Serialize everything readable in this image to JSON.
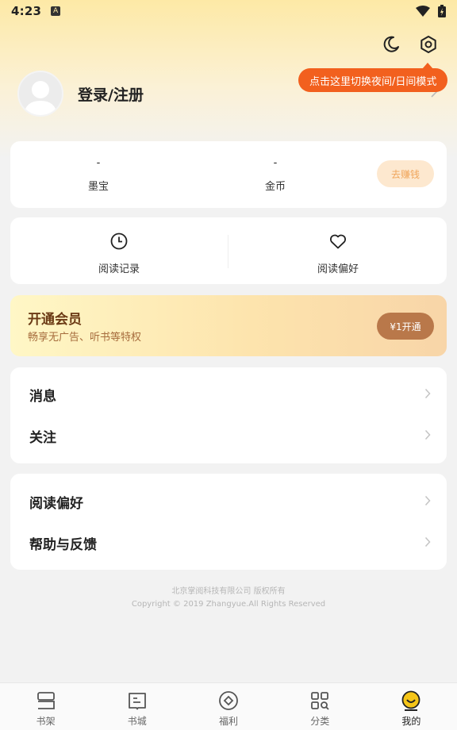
{
  "status_bar": {
    "time": "4:23",
    "notification_badge": "A"
  },
  "header": {
    "night_mode_tip": "点击这里切换夜间/日间模式",
    "icons": [
      "moon-icon",
      "settings-icon"
    ]
  },
  "profile": {
    "login_label": "登录/注册"
  },
  "wallet": {
    "items": [
      {
        "value": "-",
        "label": "墨宝"
      },
      {
        "value": "-",
        "label": "金币"
      }
    ],
    "earn_button": "去赚钱"
  },
  "shortcuts": [
    {
      "label": "阅读记录",
      "icon": "clock-icon"
    },
    {
      "label": "阅读偏好",
      "icon": "heart-icon"
    }
  ],
  "vip": {
    "title": "开通会员",
    "subtitle": "畅享无广告、听书等特权",
    "button": "¥1开通"
  },
  "menu_group_1": [
    {
      "label": "消息"
    },
    {
      "label": "关注"
    }
  ],
  "menu_group_2": [
    {
      "label": "阅读偏好"
    },
    {
      "label": "帮助与反馈"
    }
  ],
  "footer": {
    "company": "北京掌阅科技有限公司 版权所有",
    "copyright": "Copyright © 2019 Zhangyue.All Rights Reserved"
  },
  "tabbar": {
    "tabs": [
      {
        "label": "书架",
        "icon": "bookshelf-icon"
      },
      {
        "label": "书城",
        "icon": "book-store-icon"
      },
      {
        "label": "福利",
        "icon": "welfare-icon"
      },
      {
        "label": "分类",
        "icon": "category-icon"
      },
      {
        "label": "我的",
        "icon": "profile-face-icon"
      }
    ],
    "active": "我的"
  },
  "colors": {
    "accent": "#f2601e",
    "vip_button": "#b9784a",
    "earn_text": "#f0a55a",
    "active_tab": "#f5c518"
  }
}
